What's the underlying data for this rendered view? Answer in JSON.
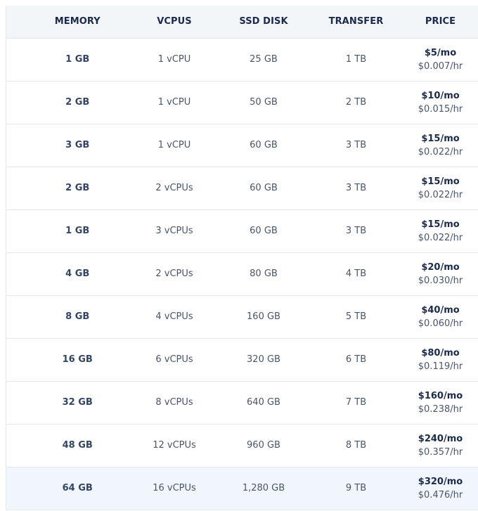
{
  "table": {
    "headers": {
      "memory": "MEMORY",
      "vcpus": "VCPUS",
      "ssd": "SSD DISK",
      "transfer": "TRANSFER",
      "price": "PRICE"
    },
    "rows": [
      {
        "memory": "1 GB",
        "vcpus": "1 vCPU",
        "ssd": "25 GB",
        "transfer": "1 TB",
        "price_mo": "$5/mo",
        "price_hr": "$0.007/hr"
      },
      {
        "memory": "2 GB",
        "vcpus": "1 vCPU",
        "ssd": "50 GB",
        "transfer": "2 TB",
        "price_mo": "$10/mo",
        "price_hr": "$0.015/hr"
      },
      {
        "memory": "3 GB",
        "vcpus": "1 vCPU",
        "ssd": "60 GB",
        "transfer": "3 TB",
        "price_mo": "$15/mo",
        "price_hr": "$0.022/hr"
      },
      {
        "memory": "2 GB",
        "vcpus": "2 vCPUs",
        "ssd": "60 GB",
        "transfer": "3 TB",
        "price_mo": "$15/mo",
        "price_hr": "$0.022/hr"
      },
      {
        "memory": "1 GB",
        "vcpus": "3 vCPUs",
        "ssd": "60 GB",
        "transfer": "3 TB",
        "price_mo": "$15/mo",
        "price_hr": "$0.022/hr"
      },
      {
        "memory": "4 GB",
        "vcpus": "2 vCPUs",
        "ssd": "80 GB",
        "transfer": "4 TB",
        "price_mo": "$20/mo",
        "price_hr": "$0.030/hr"
      },
      {
        "memory": "8 GB",
        "vcpus": "4 vCPUs",
        "ssd": "160 GB",
        "transfer": "5 TB",
        "price_mo": "$40/mo",
        "price_hr": "$0.060/hr"
      },
      {
        "memory": "16 GB",
        "vcpus": "6 vCPUs",
        "ssd": "320 GB",
        "transfer": "6 TB",
        "price_mo": "$80/mo",
        "price_hr": "$0.119/hr"
      },
      {
        "memory": "32 GB",
        "vcpus": "8 vCPUs",
        "ssd": "640 GB",
        "transfer": "7 TB",
        "price_mo": "$160/mo",
        "price_hr": "$0.238/hr"
      },
      {
        "memory": "48 GB",
        "vcpus": "12 vCPUs",
        "ssd": "960 GB",
        "transfer": "8 TB",
        "price_mo": "$240/mo",
        "price_hr": "$0.357/hr"
      },
      {
        "memory": "64 GB",
        "vcpus": "16 vCPUs",
        "ssd": "1,280 GB",
        "transfer": "9 TB",
        "price_mo": "$320/mo",
        "price_hr": "$0.476/hr"
      }
    ]
  },
  "colors": {
    "header_bg": "#f3f6f9",
    "highlight_row_bg": "#f1f6fc",
    "text_dark": "#1b2a4a",
    "text_muted": "#4a5568",
    "divider": "#e3e8ee"
  }
}
